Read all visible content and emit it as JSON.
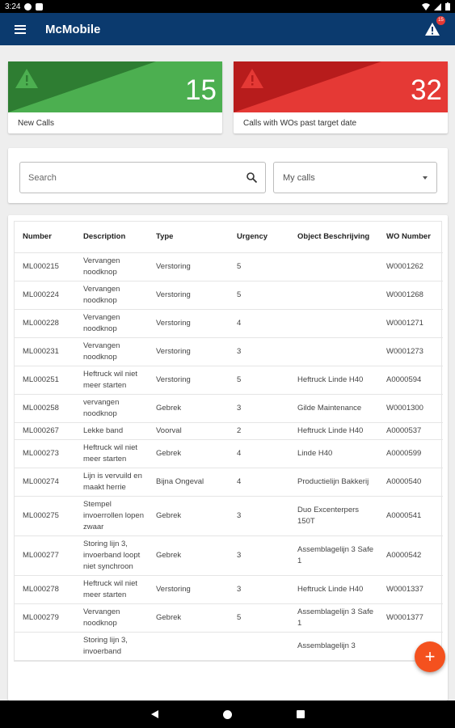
{
  "status_bar": {
    "time": "3:24"
  },
  "app_bar": {
    "title": "McMobile",
    "notification_count": "15"
  },
  "stats": [
    {
      "number": "15",
      "label": "New Calls",
      "color_light": "#4caf50",
      "color_dark": "#2e7d32"
    },
    {
      "number": "32",
      "label": "Calls with WOs past target date",
      "color_light": "#e53935",
      "color_dark": "#b71c1c"
    }
  ],
  "search": {
    "placeholder": "Search",
    "filter_value": "My calls"
  },
  "table": {
    "headers": [
      "Number",
      "Description",
      "Type",
      "Urgency",
      "Object Beschrijving",
      "WO Number"
    ],
    "rows": [
      [
        "ML000215",
        "Vervangen noodknop",
        "Verstoring",
        "5",
        "",
        "W0001262"
      ],
      [
        "ML000224",
        "Vervangen noodknop",
        "Verstoring",
        "5",
        "",
        "W0001268"
      ],
      [
        "ML000228",
        "Vervangen noodknop",
        "Verstoring",
        "4",
        "",
        "W0001271"
      ],
      [
        "ML000231",
        "Vervangen noodknop",
        "Verstoring",
        "3",
        "",
        "W0001273"
      ],
      [
        "ML000251",
        "Heftruck wil niet meer starten",
        "Verstoring",
        "5",
        "Heftruck Linde H40",
        "A0000594"
      ],
      [
        "ML000258",
        "vervangen noodknop",
        "Gebrek",
        "3",
        "Gilde Maintenance",
        "W0001300"
      ],
      [
        "ML000267",
        "Lekke band",
        "Voorval",
        "2",
        "Heftruck Linde H40",
        "A0000537"
      ],
      [
        "ML000273",
        "Heftruck wil niet meer starten",
        "Gebrek",
        "4",
        "Linde H40",
        "A0000599"
      ],
      [
        "ML000274",
        "Lijn is vervuild en maakt herrie",
        "Bijna Ongeval",
        "4",
        "Productielijn Bakkerij",
        "A0000540"
      ],
      [
        "ML000275",
        "Stempel invoerrollen lopen zwaar",
        "Gebrek",
        "3",
        "Duo Excenterpers 150T",
        "A0000541"
      ],
      [
        "ML000277",
        "Storing lijn 3, invoerband loopt niet synchroon",
        "Gebrek",
        "3",
        "Assemblagelijn 3 Safe 1",
        "A0000542"
      ],
      [
        "ML000278",
        "Heftruck wil niet meer starten",
        "Verstoring",
        "3",
        "Heftruck Linde H40",
        "W0001337"
      ],
      [
        "ML000279",
        "Vervangen noodknop",
        "Gebrek",
        "5",
        "Assemblagelijn 3 Safe 1",
        "W0001377"
      ],
      [
        "",
        "Storing lijn 3, invoerband",
        "",
        "",
        "Assemblagelijn 3",
        ""
      ]
    ]
  },
  "fab": {
    "label": "+"
  }
}
